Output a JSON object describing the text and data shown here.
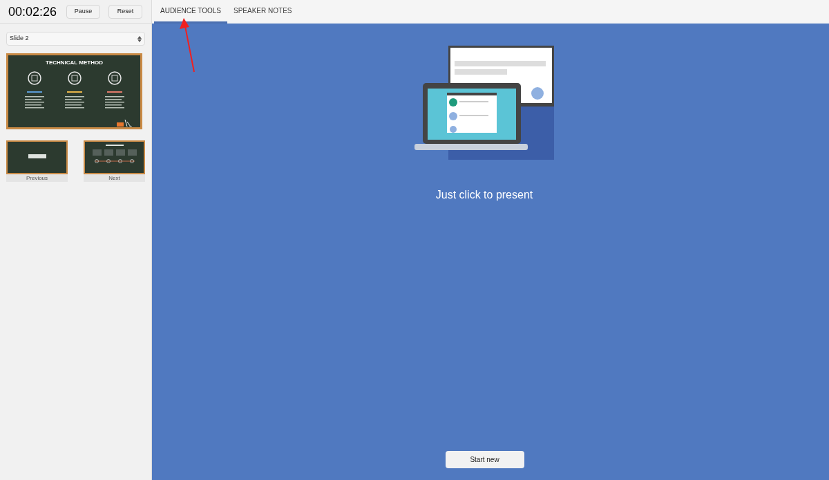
{
  "timer": {
    "elapsed": "00:02:26",
    "buttons": [
      "Pause",
      "Reset"
    ]
  },
  "slide_select": {
    "value": "Slide 2"
  },
  "current_slide": {
    "title": "TECHNICAL METHOD"
  },
  "neighbor_slides": [
    {
      "label": "Previous"
    },
    {
      "label": "Next"
    }
  ],
  "tabs": [
    {
      "label": "AUDIENCE TOOLS",
      "selected": true
    },
    {
      "label": "SPEAKER NOTES",
      "selected": false
    }
  ],
  "audience_panel": {
    "message": "Just click to present",
    "button": "Start new"
  }
}
